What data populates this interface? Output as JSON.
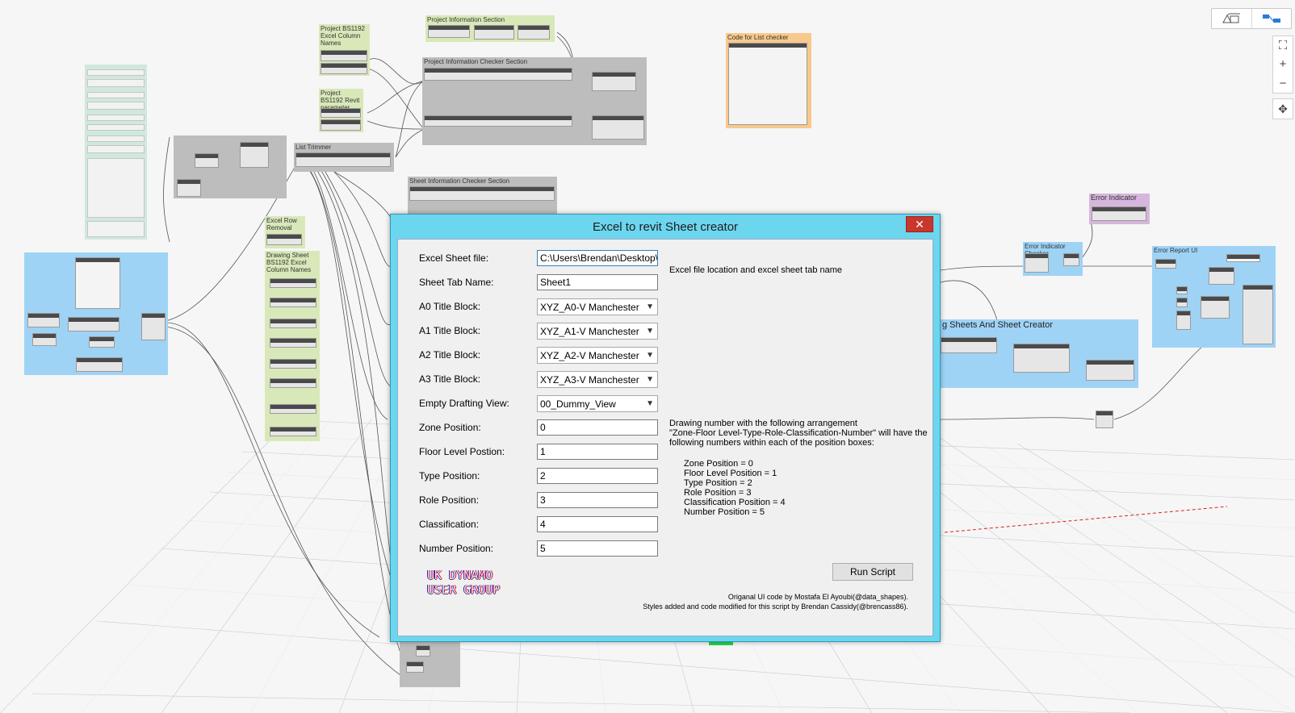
{
  "canvas": {
    "groups": [
      {
        "id": "proj-info-section",
        "title": "Project Information Section",
        "color": "#d9e8b9"
      },
      {
        "id": "proj-bs-cols",
        "title": "Project BS1192 Excel Column Names",
        "color": "#d9e8b9"
      },
      {
        "id": "proj-bs-revit",
        "title": "Project BS1192 Revit parameter",
        "color": "#d9e8b9"
      },
      {
        "id": "proj-checker",
        "title": "Project Information Checker Section",
        "color": "#bdbdbd"
      },
      {
        "id": "code-list-checker",
        "title": "Code for List checker",
        "color": "#f8c98c"
      },
      {
        "id": "list-trimmer",
        "title": "List Trimmer",
        "color": "#bdbdbd"
      },
      {
        "id": "sheet-checker",
        "title": "Sheet Information Checker Section",
        "color": "#bdbdbd"
      },
      {
        "id": "excel-row",
        "title": "Excel Row Removal",
        "color": "#d9e8b9"
      },
      {
        "id": "drawing-sheet",
        "title": "Drawing Sheet BS1192 Excel Column Names",
        "color": "#d9e8b9"
      },
      {
        "id": "error-indicator",
        "title": "Error Indicator",
        "color": "#d6b6dc"
      },
      {
        "id": "error-checker",
        "title": "Error Indicator Checker",
        "color": "#9ed3f6"
      },
      {
        "id": "error-report",
        "title": "Error Report UI",
        "color": "#9ed3f6"
      },
      {
        "id": "sheet-creator",
        "title": "g Sheets And Sheet Creator",
        "color": "#9ed3f6"
      }
    ]
  },
  "view_controls": {
    "geometry_icon": "cube-icon",
    "graph_icon": "graph-icon",
    "zoom_fit": "⛶",
    "zoom_in": "+",
    "zoom_out": "−",
    "pan": "✥"
  },
  "dialog": {
    "title": "Excel to revit Sheet creator",
    "close": "✕",
    "fields": {
      "excel_file": {
        "label": "Excel Sheet file:",
        "value": "C:\\Users\\Brendan\\Desktop\\"
      },
      "sheet_tab": {
        "label": "Sheet Tab Name:",
        "value": "Sheet1"
      },
      "a0": {
        "label": "A0 Title Block:",
        "value": "XYZ_A0-V Manchester"
      },
      "a1": {
        "label": "A1 Title Block:",
        "value": "XYZ_A1-V Manchester"
      },
      "a2": {
        "label": "A2 Title Block:",
        "value": "XYZ_A2-V Manchester"
      },
      "a3": {
        "label": "A3 Title Block:",
        "value": "XYZ_A3-V Manchester"
      },
      "drafting": {
        "label": "Empty Drafting View:",
        "value": "00_Dummy_View"
      },
      "zone": {
        "label": "Zone Position:",
        "value": "0"
      },
      "floor": {
        "label": "Floor Level Postion:",
        "value": "1"
      },
      "type": {
        "label": "Type Position:",
        "value": "2"
      },
      "role": {
        "label": "Role Position:",
        "value": "3"
      },
      "classification": {
        "label": "Classification:",
        "value": "4"
      },
      "number": {
        "label": "Number Position:",
        "value": "5"
      }
    },
    "info_file": "Excel file location and excel sheet tab name",
    "info_drawing": [
      "Drawing number with the following arrangement",
      "\"Zone-Floor Level-Type-Role-Classification-Number\" will have the",
      "following numbers within each of the position boxes:"
    ],
    "positions": [
      "Zone Position = 0",
      "Floor Level Position = 1",
      "Type Position = 2",
      "Role Position = 3",
      "Classification Position = 4",
      "Number Position = 5"
    ],
    "run_button": "Run Script",
    "logo_line1": "UK DYNAMO",
    "logo_line2": "USER GROUP",
    "credit1": "Origanal UI code by Mostafa El Ayoubi(@data_shapes).",
    "credit2": "Styles added and code modified for this script by Brendan Cassidy(@brencass86)."
  }
}
